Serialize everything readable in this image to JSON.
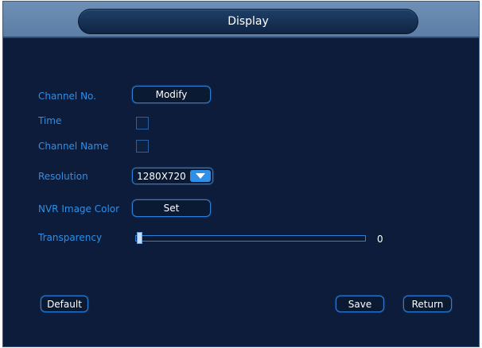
{
  "window": {
    "title": "Display"
  },
  "form": {
    "channel_no_label": "Channel No.",
    "channel_no_button": "Modify",
    "time_label": "Time",
    "time_checked": false,
    "channel_name_label": "Channel Name",
    "channel_name_checked": false,
    "resolution_label": "Resolution",
    "resolution_value": "1280X720",
    "nvr_color_label": "NVR Image Color",
    "nvr_color_button": "Set",
    "transparency_label": "Transparency",
    "transparency_value": "0"
  },
  "footer": {
    "default_label": "Default",
    "save_label": "Save",
    "return_label": "Return"
  },
  "colors": {
    "background": "#0c1c3a",
    "label": "#2f8fe6",
    "accent": "#2d7ed8",
    "titlebar": "#6f90b6"
  },
  "icons": {
    "resolution_dropdown": "chevron-down-icon"
  }
}
